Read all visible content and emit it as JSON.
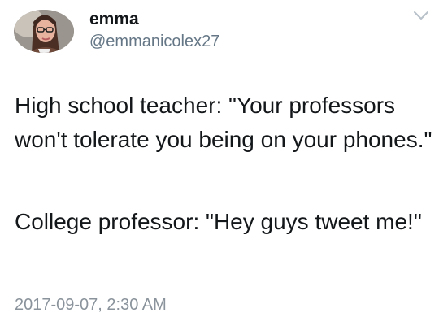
{
  "author": {
    "display_name": "emma",
    "handle": "@emmanicolex27",
    "avatar_icon": "profile-photo"
  },
  "menu_icon": "chevron-down-icon",
  "tweet": {
    "paragraphs": [
      "High school teacher: \"Your professors won't tolerate you being on your phones.\"",
      "College professor: \"Hey guys tweet me!\""
    ],
    "timestamp": "2017-09-07, 2:30 AM"
  },
  "colors": {
    "text": "#14171a",
    "secondary_text": "#657786",
    "timestamp_text": "#8a939b",
    "chevron": "#b8c1c9",
    "background": "#ffffff"
  }
}
